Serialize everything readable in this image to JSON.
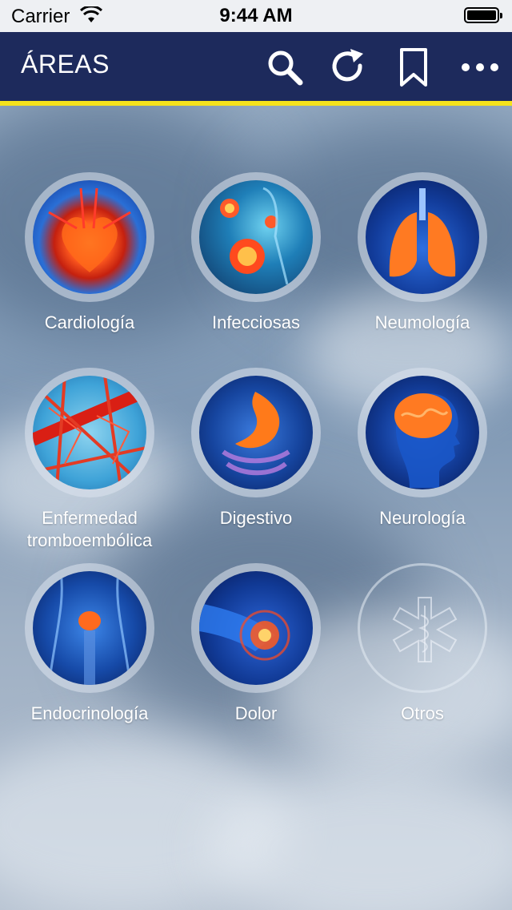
{
  "status_bar": {
    "carrier": "Carrier",
    "time": "9:44 AM"
  },
  "nav": {
    "title": "ÁREAS",
    "icons": [
      "search-icon",
      "refresh-icon",
      "bookmark-icon",
      "more-icon"
    ]
  },
  "areas": [
    {
      "label": "Cardiología",
      "icon": "heart-icon"
    },
    {
      "label": "Infecciosas",
      "icon": "virus-icon"
    },
    {
      "label": "Neumología",
      "icon": "lungs-icon"
    },
    {
      "label": "Enfermedad\ntromboembólica",
      "icon": "blood-vessels-icon"
    },
    {
      "label": "Digestivo",
      "icon": "stomach-icon"
    },
    {
      "label": "Neurología",
      "icon": "brain-icon"
    },
    {
      "label": "Endocrinología",
      "icon": "thyroid-icon"
    },
    {
      "label": "Dolor",
      "icon": "joint-icon"
    },
    {
      "label": "Otros",
      "icon": "star-of-life-icon"
    }
  ],
  "colors": {
    "nav_background": "#1d2a5c",
    "nav_underline": "#f5e21c",
    "label_text": "#ffffff"
  }
}
